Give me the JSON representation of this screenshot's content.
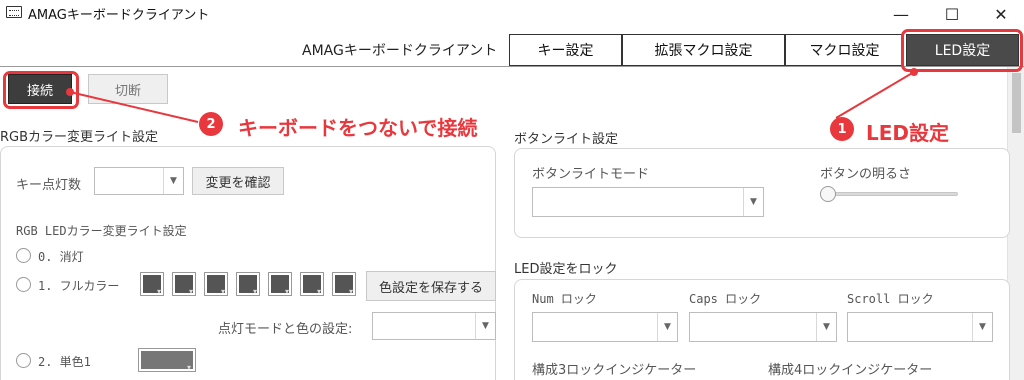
{
  "window": {
    "title": "AMAGキーボードクライアント",
    "minimize": "—",
    "maximize": "☐",
    "close": "✕"
  },
  "tabs": {
    "heading": "AMAGキーボードクライアント",
    "items": [
      {
        "label": "キー設定"
      },
      {
        "label": "拡張マクロ設定"
      },
      {
        "label": "マクロ設定"
      },
      {
        "label": "LED設定"
      }
    ]
  },
  "toolbar": {
    "connect": "接続",
    "disconnect": "切断"
  },
  "left": {
    "section_title": "RGBカラー変更ライト設定",
    "key_count_label": "キー点灯数",
    "confirm_button": "変更を確認",
    "rgb_title": "RGB LEDカラー変更ライト設定",
    "radios": [
      {
        "label": "0. 消灯"
      },
      {
        "label": "1. フルカラー"
      },
      {
        "label": "2. 単色1"
      }
    ],
    "save_color_button": "色設定を保存する",
    "mode_label": "点灯モードと色の設定:"
  },
  "right": {
    "button_light_title": "ボタンライト設定",
    "button_light_mode_label": "ボタンライトモード",
    "brightness_label": "ボタンの明るさ",
    "brightness_level": 0.0,
    "lock_title": "LED設定をロック",
    "num_lock": "Num ロック",
    "caps_lock": "Caps ロック",
    "scroll_lock": "Scroll ロック",
    "indicator3": "構成3ロックインジケーター",
    "indicator4": "構成4ロックインジケーター"
  },
  "annotations": {
    "one": {
      "number": "1",
      "text": "LED設定"
    },
    "two": {
      "number": "2",
      "text": "キーボードをつないで接続"
    }
  },
  "colors": {
    "annotation_red": "#e8383d",
    "active_tab": "#4a4a4a",
    "connect_button": "#3d3d3d"
  }
}
